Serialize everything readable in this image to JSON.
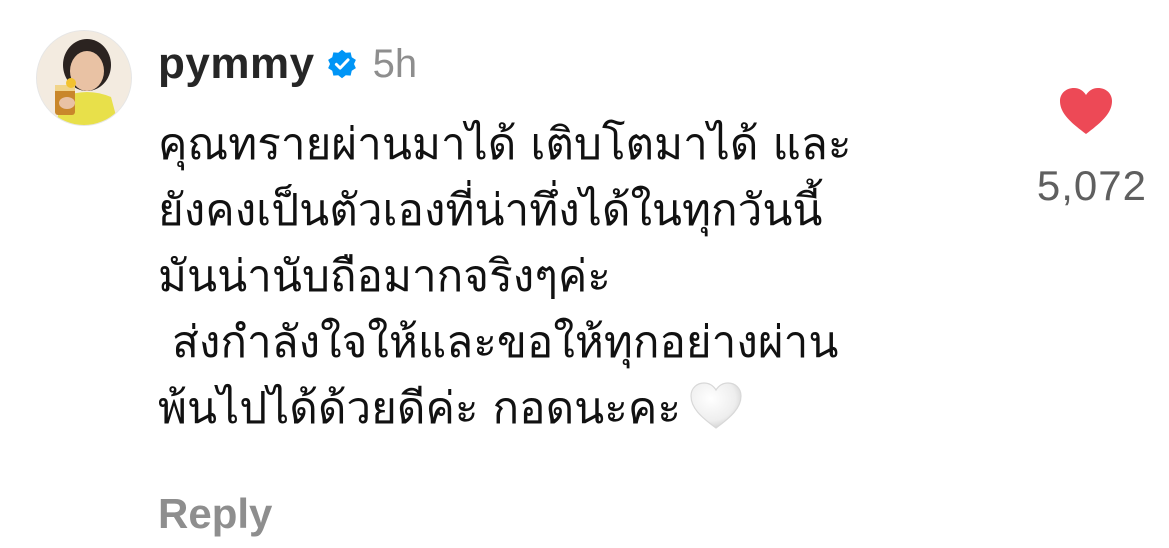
{
  "comment": {
    "username": "pymmy",
    "verified": true,
    "time_ago": "5h",
    "text_lines": [
      "คุณทรายผ่านมาได้ เติบโตมาได้ และ",
      "ยังคงเป็นตัวเองที่น่าทึ่งได้ในทุกวันนี้",
      "มันน่านับถือมากจริงๆค่ะ",
      " ส่งกำลังใจให้และขอให้ทุกอย่างผ่าน",
      "พ้นไปได้ด้วยดีค่ะ กอดนะคะ"
    ],
    "trailing_emoji": "white-heart-emoji",
    "reply_label": "Reply",
    "like_count": "5,072",
    "liked": true
  },
  "colors": {
    "like_heart": "#ED4956",
    "verified_badge": "#0095F6",
    "secondary_text": "#8E8E8E"
  },
  "icons": {
    "verified": "verified-badge-icon",
    "like": "heart-filled-icon",
    "emoji": "white-heart-emoji"
  }
}
